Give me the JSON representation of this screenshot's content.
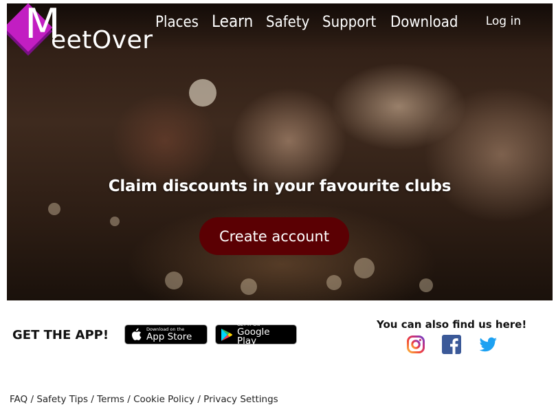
{
  "brand": {
    "logo_first": "M",
    "logo_rest": "eetOver"
  },
  "nav": {
    "items": [
      "Places",
      "Learn",
      "Safety",
      "Support",
      "Download"
    ],
    "login": "Log in"
  },
  "hero": {
    "tagline": "Claim discounts in your favourite clubs",
    "cta": "Create account"
  },
  "apps": {
    "heading": "GET THE APP!",
    "appstore_small": "Download on the",
    "appstore_big": "App Store",
    "gplay_small": "GET IT ON",
    "gplay_big": "Google Play"
  },
  "social": {
    "heading": "You can also find us here!",
    "icons": [
      "instagram-icon",
      "facebook-icon",
      "twitter-icon"
    ]
  },
  "footer": {
    "links": [
      "FAQ",
      "Safety Tips",
      "Terms",
      "Cookie Policy",
      "Privacy Settings"
    ],
    "separator": "/"
  },
  "colors": {
    "brand_magenta": "#c21ec2",
    "cta_bg": "#5b0003",
    "facebook": "#3b5998",
    "twitter": "#1da1f2"
  }
}
